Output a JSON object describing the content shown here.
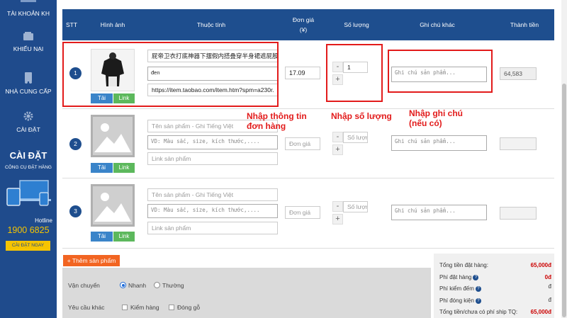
{
  "sidebar": {
    "items": [
      {
        "label": "TÀI KHOẢN KH"
      },
      {
        "label": "KHIẾU NẠI"
      },
      {
        "label": "NHÀ CUNG CẤP"
      },
      {
        "label": "CÀI ĐẶT"
      }
    ],
    "promo": {
      "title": "CÀI ĐẶT",
      "subtitle": "CÔNG CỤ ĐẶT HÀNG"
    },
    "hotline_label": "Hotline",
    "hotline_number": "1900 6825",
    "install_button": "CÀI ĐẶT NGAY"
  },
  "table": {
    "headers": {
      "stt": "STT",
      "image": "Hình ảnh",
      "attributes": "Thuộc tính",
      "price_line1": "Đơn giá",
      "price_line2": "(¥)",
      "qty": "Số lượng",
      "note": "Ghi chú khác",
      "total": "Thành tiền"
    },
    "buttons": {
      "download": "Tải",
      "link": "Link"
    },
    "placeholders": {
      "name": "Tên sản phẩm - Ghi Tiếng Việt",
      "desc": "VD: Màu sắc, size, kích thước,....",
      "link": "Link sản phẩm",
      "price": "Đơn giá",
      "qty": "Số lượn",
      "note": "Ghi chú sản phẩm..."
    },
    "rows": [
      {
        "num": "1",
        "name": "屁帝卫衣打底神器下摆假内搭叠穿半身裙遮屁股",
        "desc": "đen",
        "link": "https://item.taobao.com/item.htm?spm=a230r.",
        "price": "17.09",
        "qty": "1",
        "total": "64,583"
      },
      {
        "num": "2"
      },
      {
        "num": "3"
      }
    ]
  },
  "annotations": {
    "info": "Nhập thông tin đơn hàng",
    "qty": "Nhập số lượng",
    "note_line1": "Nhập ghi chú",
    "note_line2": "(nếu có)"
  },
  "add_product_button": "+ Thêm sản phẩm",
  "footer": {
    "shipping_label": "Vận chuyển",
    "shipping_options": [
      "Nhanh",
      "Thường"
    ],
    "other_label": "Yêu cầu khác",
    "other_options": [
      "Kiểm hàng",
      "Đóng gỗ"
    ]
  },
  "totals": [
    {
      "label": "Tổng tiền đặt hàng:",
      "value": "65,000đ"
    },
    {
      "label": "Phí đặt hàng",
      "value": "0đ"
    },
    {
      "label": "Phí kiểm đếm",
      "value": "đ"
    },
    {
      "label": "Phí đóng kiện",
      "value": "đ"
    },
    {
      "label": "Tổng tiền/chưa có phí ship TQ:",
      "value": "65,000đ"
    }
  ],
  "colors": {
    "sidebar_bg": "#1f4b8c",
    "header_bg": "#1e4e8e",
    "annotation_red": "#e21b1b",
    "add_button": "#f26522",
    "hotline": "#f5c400"
  }
}
